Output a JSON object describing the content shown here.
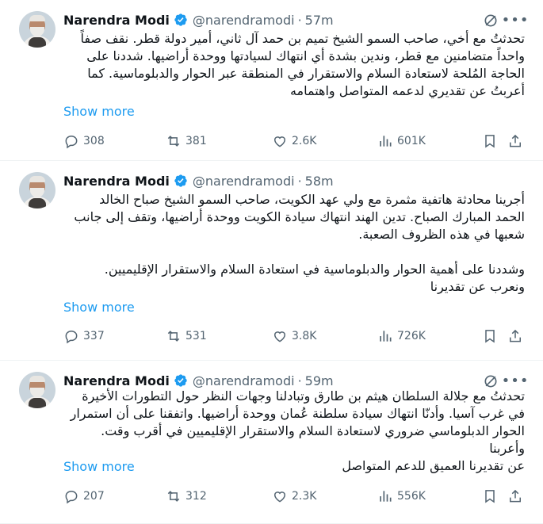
{
  "tweets": [
    {
      "author_name": "Narendra Modi",
      "handle": "@narendramodi",
      "separator": "·",
      "time": "57m",
      "text": "تحدثتُ مع أخي، صاحب السمو الشيخ تميم بن حمد آل ثاني، أمير دولة قطر. نقف صفاً\nواحداً متضامنين مع قطر، وندين بشدة أي انتهاك لسيادتها ووحدة أراضيها. شددنا على\nالحاجة المُلحة لاستعادة السلام والاستقرار في المنطقة عبر الحوار والدبلوماسية. كما\nأعربتُ عن تقديري لدعمه المتواصل واهتمامه",
      "show_more": "Show more",
      "replies": "308",
      "retweets": "381",
      "likes": "2.6K",
      "views": "601K"
    },
    {
      "author_name": "Narendra Modi",
      "handle": "@narendramodi",
      "separator": "·",
      "time": "58m",
      "text": "أجرينا محادثة هاتفية مثمرة مع ولي عهد الكويت، صاحب السمو الشيخ صباح الخالد\nالحمد المبارك الصباح. تدين الهند انتهاك سيادة الكويت ووحدة أراضيها، وتقف إلى جانب\nشعبها في هذه الظروف الصعبة.\n\nوشددنا على أهمية الحوار والدبلوماسية في استعادة السلام والاستقرار الإقليميين.\nونعرب عن تقديرنا",
      "show_more": "Show more",
      "replies": "337",
      "retweets": "531",
      "likes": "3.8K",
      "views": "726K"
    },
    {
      "author_name": "Narendra Modi",
      "handle": "@narendramodi",
      "separator": "·",
      "time": "59m",
      "text": "تحدثتُ مع جلالة السلطان هيثم بن طارق وتبادلنا وجهات النظر حول التطورات الأخيرة\nفي غرب آسيا. وأدنّا انتهاك سيادة سلطنة عُمان ووحدة أراضيها. واتفقنا على أن استمرار\nالحوار الدبلوماسي ضروري لاستعادة السلام والاستقرار الإقليميين في أقرب وقت. وأعربنا\nعن تقديرنا العميق للدعم المتواصل",
      "show_more": "Show more",
      "replies": "207",
      "retweets": "312",
      "likes": "2.3K",
      "views": "556K"
    }
  ],
  "colors": {
    "text_primary": "#0f1419",
    "text_secondary": "#536471",
    "link": "#1d9bf0",
    "verified": "#1d9bf0",
    "divider": "#eff3f4"
  },
  "icons": [
    "verified-badge-icon",
    "grok-icon",
    "more-icon",
    "reply-icon",
    "retweet-icon",
    "like-icon",
    "views-icon",
    "bookmark-icon",
    "share-icon"
  ]
}
